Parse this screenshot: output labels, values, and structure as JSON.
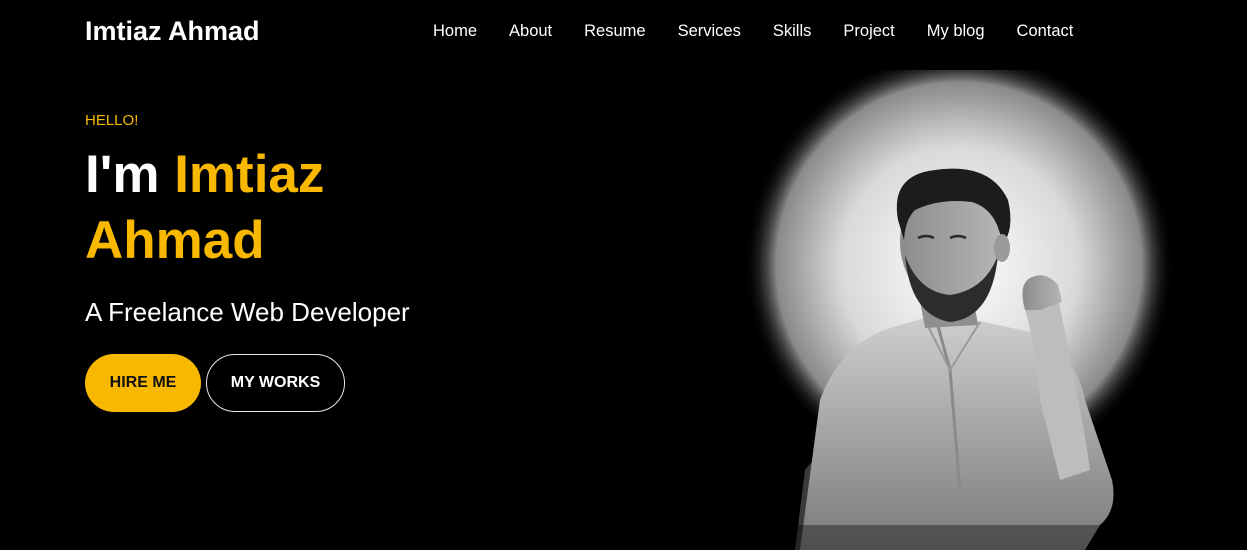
{
  "header": {
    "brand": "Imtiaz Ahmad",
    "nav": [
      "Home",
      "About",
      "Resume",
      "Services",
      "Skills",
      "Project",
      "My blog",
      "Contact"
    ]
  },
  "hero": {
    "greeting": "HELLO!",
    "intro": "I'm",
    "name_line1": "Imtiaz",
    "name_line2": "Ahmad",
    "subtitle": "A Freelance Web Developer",
    "hire_button": "HIRE ME",
    "works_button": "MY WORKS"
  },
  "colors": {
    "accent": "#f9b800",
    "background": "#000000",
    "text": "#ffffff"
  },
  "icons": {
    "portrait": "person-portrait-image"
  }
}
